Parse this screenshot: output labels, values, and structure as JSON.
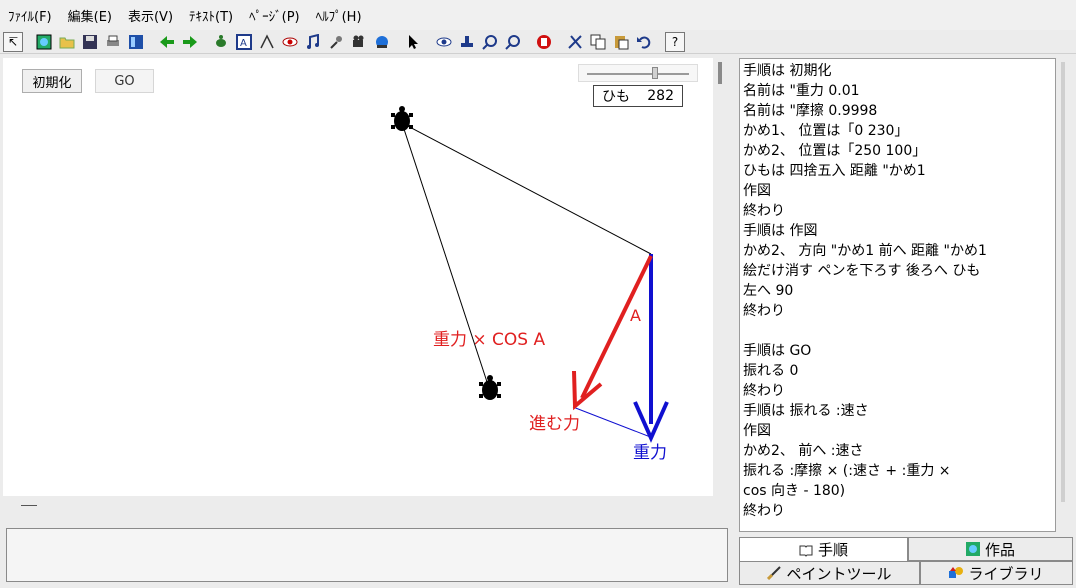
{
  "menu": [
    "ﾌｧｲﾙ(F)",
    "編集(E)",
    "表示(V)",
    "ﾃｷｽﾄ(T)",
    "ﾍﾟｰｼﾞ(P)",
    "ﾍﾙﾌﾟ(H)"
  ],
  "toolbar": {
    "help_label": "?"
  },
  "canvas": {
    "init_label": "初期化",
    "go_label": "GO",
    "himo_label": "ひも",
    "himo_value": "282",
    "slider_value": 0.65,
    "labels": {
      "cos_label": "重力 × COS A",
      "angle_label": "A",
      "susumu_label": "進む力",
      "gravity_label": "重力"
    },
    "colors": {
      "red": "#e02020",
      "blue": "#1010d0"
    }
  },
  "code_lines": [
    "手順は 初期化",
    "名前は \"重力 0.01",
    "名前は \"摩擦 0.9998",
    "かめ1、 位置は「0 230」",
    "かめ2、 位置は「250 100」",
    "ひもは 四捨五入 距離 \"かめ1",
    "作図",
    "終わり",
    "手順は 作図",
    "かめ2、 方向 \"かめ1 前へ 距離 \"かめ1",
    "絵だけ消す ペンを下ろす 後ろへ ひも",
    "左へ 90",
    "終わり",
    "",
    "手順は GO",
    "振れる 0",
    "終わり",
    "手順は 振れる :速さ",
    "作図",
    "かめ2、 前へ :速さ",
    "振れる :摩擦 × (:速さ + :重力 ×",
    "cos 向き - 180)",
    "終わり"
  ],
  "tabs": {
    "procedure": "手順",
    "work": "作品",
    "paint": "ペイントツール",
    "library": "ライブラリ"
  }
}
